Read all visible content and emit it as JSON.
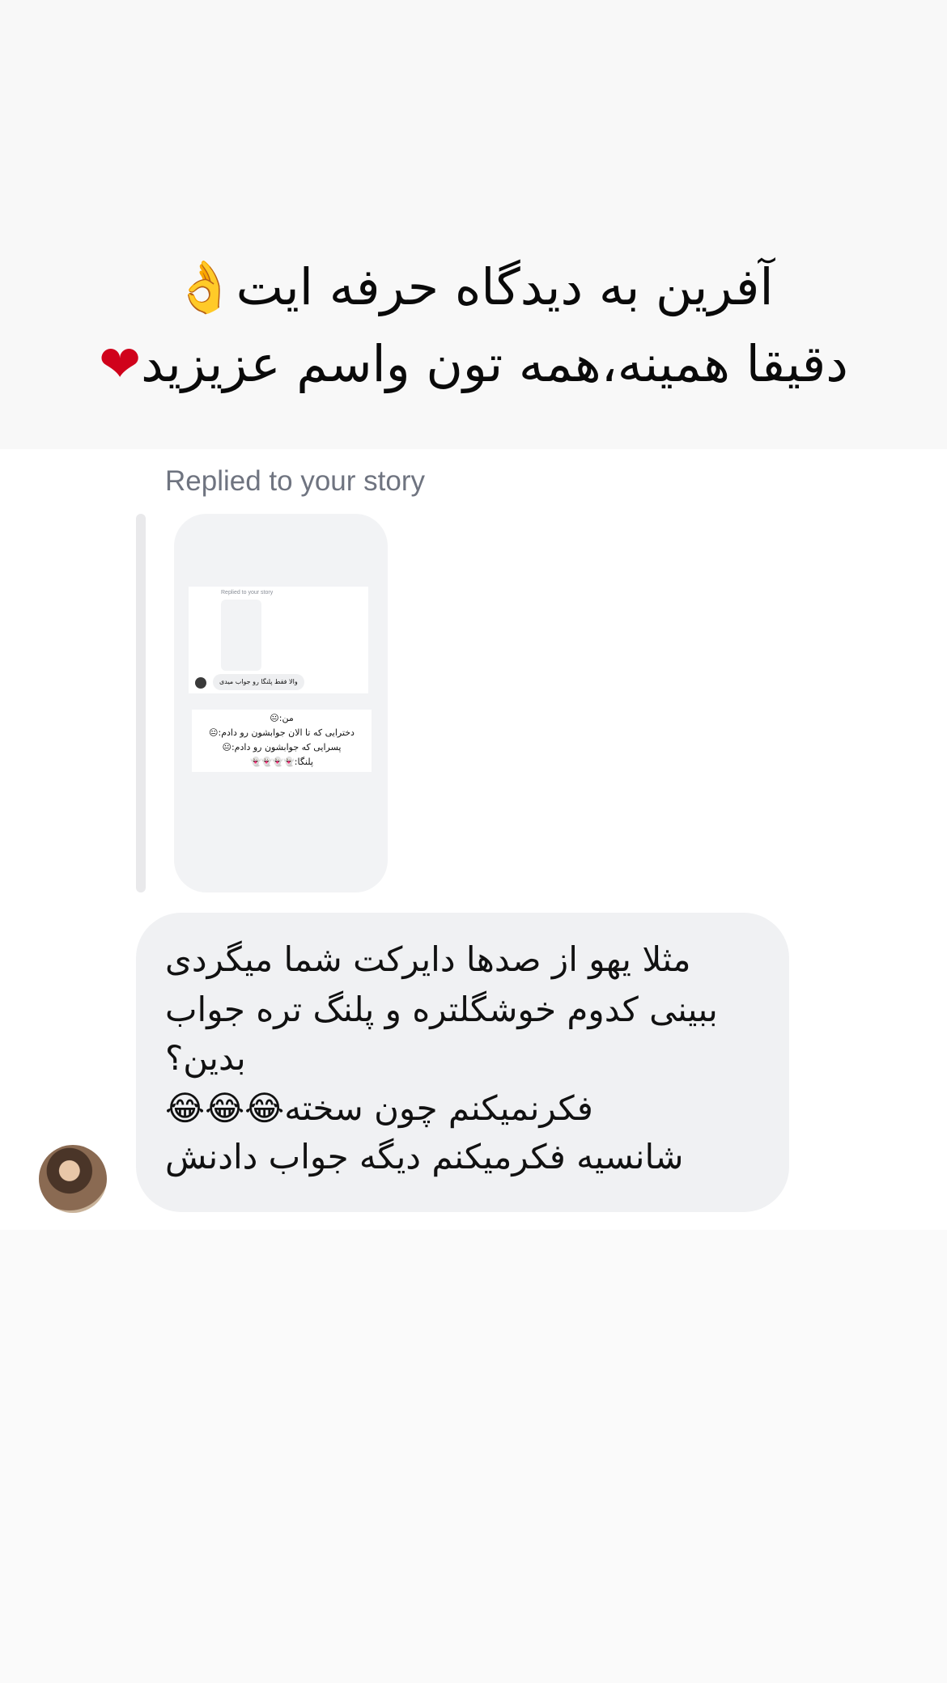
{
  "caption": {
    "line1_text": "آفرین به دیدگاه حرفه ایت",
    "line1_emoji": "👌",
    "line2_text": "دقیقا همینه،همه تون واسم عزیزید",
    "line2_emoji": "❤"
  },
  "thread": {
    "replied_label": "Replied to your story",
    "story_preview": {
      "inner_replied_label": "Replied to your story",
      "inner_reply_text": "والا فقط پلنگا رو جواب میدی",
      "lines": [
        "من:😐",
        "دخترایی که تا الان جوابشون رو دادم:😐",
        "پسرایی که جوابشون رو دادم:😐",
        "پلنگا:👻👻👻👻"
      ]
    },
    "message": {
      "lines": [
        "مثلا یهو از صدها دایرکت شما میگردی",
        "ببینی کدوم خوشگلتره و پلنگ تره جواب",
        "بدین؟",
        "فکرنمیکنم چون سخته😂😂😂",
        "شانسیه فکرمیکنم دیگه جواب دادنش"
      ]
    }
  },
  "colors": {
    "page_bg": "#fafafa",
    "bubble_bg": "#f0f1f3",
    "label_gray": "#6f7480",
    "heart": "#d0021b"
  }
}
